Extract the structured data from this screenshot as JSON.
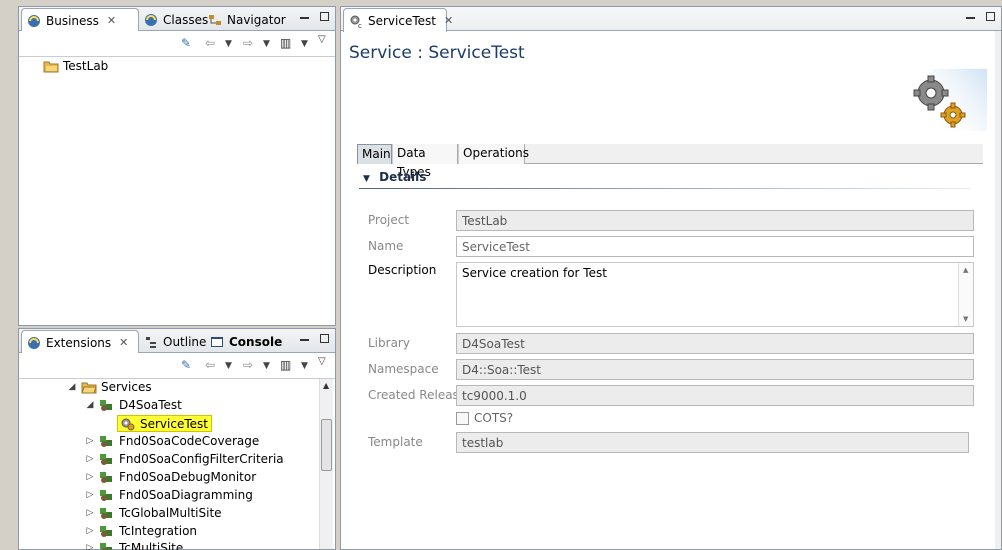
{
  "left_top": {
    "tabs": [
      {
        "label": "Business",
        "active": true
      },
      {
        "label": "Classes",
        "active": false
      },
      {
        "label": "Navigator",
        "active": false
      }
    ],
    "tree": [
      {
        "label": "TestLab"
      }
    ]
  },
  "left_bottom": {
    "tabs": [
      {
        "label": "Extensions",
        "active": true
      },
      {
        "label": "Outline",
        "active": false
      },
      {
        "label": "Console",
        "active": false
      }
    ],
    "tree": [
      {
        "label": "Services",
        "toggle": "◢",
        "icon": "folder-icon"
      },
      {
        "label": "D4SoaTest",
        "toggle": "◢",
        "icon": "library-icon"
      },
      {
        "label": "ServiceTest",
        "toggle": "",
        "icon": "service-icon",
        "highlighted": true
      },
      {
        "label": "Fnd0SoaCodeCoverage",
        "toggle": "▷",
        "icon": "library-icon"
      },
      {
        "label": "Fnd0SoaConfigFilterCriteria",
        "toggle": "▷",
        "icon": "library-icon"
      },
      {
        "label": "Fnd0SoaDebugMonitor",
        "toggle": "▷",
        "icon": "library-icon"
      },
      {
        "label": "Fnd0SoaDiagramming",
        "toggle": "▷",
        "icon": "library-icon"
      },
      {
        "label": "TcGlobalMultiSite",
        "toggle": "▷",
        "icon": "library-icon"
      },
      {
        "label": "TcIntegration",
        "toggle": "▷",
        "icon": "library-icon"
      },
      {
        "label": "TcMultiSite",
        "toggle": "▷",
        "icon": "library-icon"
      }
    ]
  },
  "editor": {
    "tab_label": "ServiceTest",
    "title": "Service : ServiceTest",
    "section_tabs": [
      "Main",
      "Data Types",
      "Operations"
    ],
    "section_header": "Details",
    "fields": {
      "project": {
        "label": "Project",
        "value": "TestLab"
      },
      "name": {
        "label": "Name",
        "value": "ServiceTest"
      },
      "description": {
        "label": "Description",
        "value": "Service creation for Test"
      },
      "library": {
        "label": "Library",
        "value": "D4SoaTest"
      },
      "namespace": {
        "label": "Namespace",
        "value": "D4::Soa::Test"
      },
      "created_release": {
        "label": "Created Release",
        "value": "tc9000.1.0"
      },
      "cots": {
        "label": "COTS?",
        "checked": false
      },
      "template": {
        "label": "Template",
        "value": "testlab"
      }
    }
  },
  "colors": {
    "title": "#1b3c68",
    "highlight": "#ffff33",
    "panel_border": "#8f9aa8"
  }
}
